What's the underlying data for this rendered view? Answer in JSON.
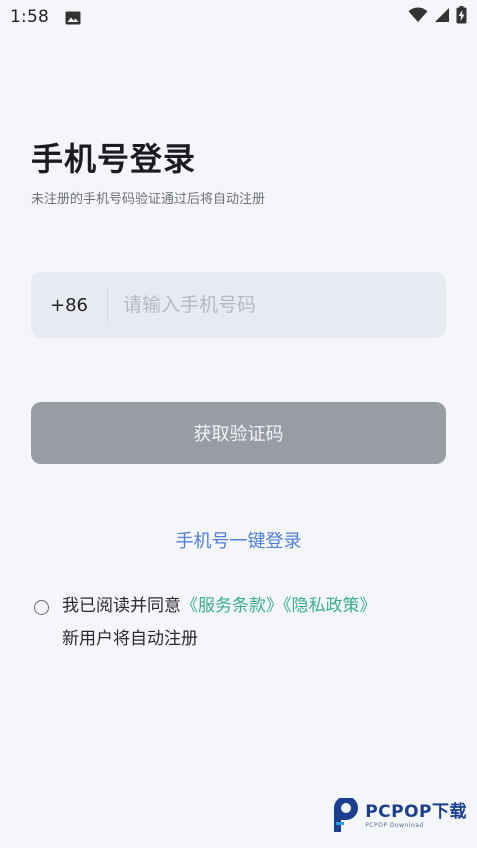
{
  "status_bar": {
    "time": "1:58",
    "icons": [
      "photo-icon",
      "wifi-icon",
      "cellular-signal-icon",
      "battery-charging-icon"
    ]
  },
  "login": {
    "title": "手机号登录",
    "subtitle": "未注册的手机号码验证通过后将自动注册",
    "country_code": "+86",
    "phone_placeholder": "请输入手机号码",
    "phone_value": "",
    "get_code_label": "获取验证码",
    "one_click_login_label": "手机号一键登录"
  },
  "agreement": {
    "checked": false,
    "prefix": "我已阅读并同意",
    "terms_label": "《服务条款》",
    "privacy_label": "《隐私政策》",
    "note": "新用户将自动注册"
  },
  "watermark": {
    "brand": "PCPOP下载",
    "tagline": "PCPOP Download"
  },
  "colors": {
    "background": "#f5f6fa",
    "input_background": "#e8eaf1",
    "button_disabled": "#9a9ca3",
    "link_blue": "#4f7fd6",
    "link_green": "#3aaf8c",
    "watermark_blue": "#1b3f8e"
  }
}
